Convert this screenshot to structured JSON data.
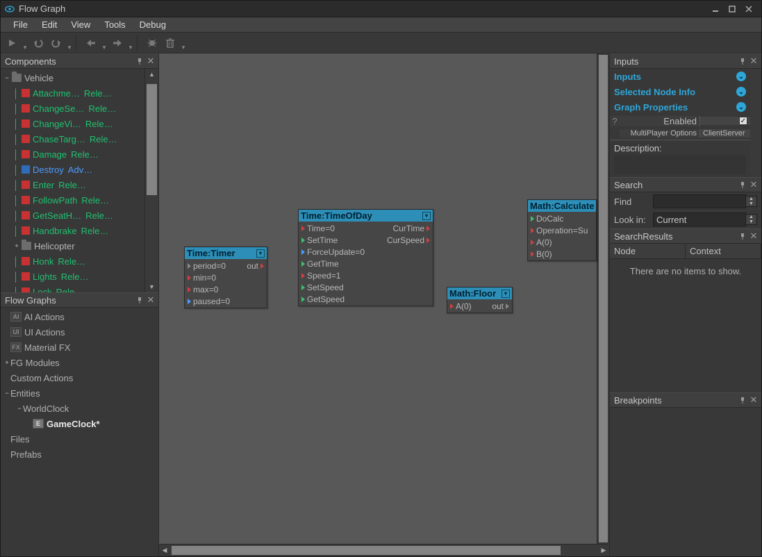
{
  "window": {
    "title": "Flow Graph"
  },
  "menu": {
    "items": [
      "File",
      "Edit",
      "View",
      "Tools",
      "Debug"
    ]
  },
  "panels": {
    "components": {
      "title": "Components"
    },
    "flowgraphs": {
      "title": "Flow Graphs"
    },
    "inputs": {
      "title": "Inputs"
    },
    "search": {
      "title": "Search"
    },
    "searchresults": {
      "title": "SearchResults"
    },
    "breakpoints": {
      "title": "Breakpoints"
    }
  },
  "components_tree": {
    "root": "Vehicle",
    "helicopter_label": "Helicopter",
    "items": [
      {
        "name": "Attachme…",
        "status": "Rele…",
        "color": "red"
      },
      {
        "name": "ChangeSe…",
        "status": "Rele…",
        "color": "red"
      },
      {
        "name": "ChangeVi…",
        "status": "Rele…",
        "color": "red"
      },
      {
        "name": "ChaseTarg…",
        "status": "Rele…",
        "color": "red"
      },
      {
        "name": "Damage",
        "status": "Rele…",
        "color": "red"
      },
      {
        "name": "Destroy",
        "status": "Adv…",
        "color": "blue"
      },
      {
        "name": "Enter",
        "status": "Rele…",
        "color": "red"
      },
      {
        "name": "FollowPath",
        "status": "Rele…",
        "color": "red"
      },
      {
        "name": "GetSeatH…",
        "status": "Rele…",
        "color": "red"
      },
      {
        "name": "Handbrake",
        "status": "Rele…",
        "color": "red"
      }
    ],
    "items2": [
      {
        "name": "Honk",
        "status": "Rele…",
        "color": "red"
      },
      {
        "name": "Lights",
        "status": "Rele…",
        "color": "red"
      },
      {
        "name": "Lock",
        "status": "Rele…",
        "color": "red"
      }
    ]
  },
  "flowgraphs_tree": {
    "items": [
      {
        "label": "AI Actions",
        "ic": "AI"
      },
      {
        "label": "UI Actions",
        "ic": "UI"
      },
      {
        "label": "Material FX",
        "ic": "FX"
      },
      {
        "label": "FG Modules",
        "ic": "",
        "folder": true,
        "tw": "+"
      },
      {
        "label": "Custom Actions",
        "ic": "",
        "folder": true
      },
      {
        "label": "Entities",
        "ic": "",
        "folder": true,
        "tw": "−"
      }
    ],
    "child": {
      "label": "WorldClock",
      "tw": "−"
    },
    "active": {
      "label": "GameClock*"
    },
    "tail": [
      {
        "label": "Files"
      },
      {
        "label": "Prefabs"
      }
    ]
  },
  "nodes": {
    "timer": {
      "title": "Time:Timer",
      "ports_in": [
        {
          "label": "period=0",
          "c": "grey"
        },
        {
          "label": "min=0",
          "c": "red"
        },
        {
          "label": "max=0",
          "c": "red"
        },
        {
          "label": "paused=0",
          "c": "blue"
        }
      ],
      "ports_out": [
        {
          "label": "out",
          "c": "red"
        }
      ]
    },
    "tod": {
      "title": "Time:TimeOfDay",
      "ports_in": [
        {
          "label": "Time=0",
          "c": "red"
        },
        {
          "label": "SetTime",
          "c": "green"
        },
        {
          "label": "ForceUpdate=0",
          "c": "blue"
        },
        {
          "label": "GetTime",
          "c": "green"
        },
        {
          "label": "Speed=1",
          "c": "red"
        },
        {
          "label": "SetSpeed",
          "c": "green"
        },
        {
          "label": "GetSpeed",
          "c": "green"
        }
      ],
      "ports_out": [
        {
          "label": "CurTime",
          "c": "red"
        },
        {
          "label": "CurSpeed",
          "c": "red"
        }
      ]
    },
    "floor": {
      "title": "Math:Floor",
      "ports_in": [
        {
          "label": "A(0)",
          "c": "red"
        }
      ],
      "ports_out": [
        {
          "label": "out",
          "c": "grey"
        }
      ]
    },
    "calc": {
      "title": "Math:Calculate",
      "ports_in": [
        {
          "label": "DoCalc",
          "c": "green"
        },
        {
          "label": "Operation=Su",
          "c": "red"
        },
        {
          "label": "A(0)",
          "c": "red"
        },
        {
          "label": "B(0)",
          "c": "red"
        }
      ]
    }
  },
  "inputs_panel": {
    "sections": [
      "Inputs",
      "Selected Node Info",
      "Graph Properties"
    ],
    "rows": [
      {
        "k": "Enabled",
        "v": "",
        "checkbox": true,
        "q": "?"
      },
      {
        "k": "MultiPlayer Options",
        "v": "ClientServer"
      }
    ],
    "description_label": "Description:"
  },
  "search_panel": {
    "find_label": "Find",
    "lookin_label": "Look in:",
    "lookin_value": "Current",
    "results_cols": [
      "Node",
      "Context"
    ],
    "empty_msg": "There are no items to show."
  }
}
